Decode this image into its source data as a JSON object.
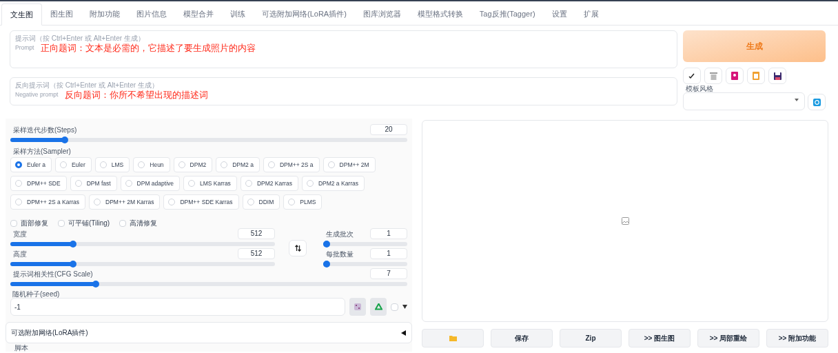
{
  "tabs": [
    {
      "label": "文生图",
      "selected": true
    },
    {
      "label": "图生图",
      "selected": false
    },
    {
      "label": "附加功能",
      "selected": false
    },
    {
      "label": "图片信息",
      "selected": false
    },
    {
      "label": "模型合并",
      "selected": false
    },
    {
      "label": "训练",
      "selected": false
    },
    {
      "label": "可选附加网络(LoRA插件)",
      "selected": false
    },
    {
      "label": "图库浏览器",
      "selected": false
    },
    {
      "label": "模型格式转换",
      "selected": false
    },
    {
      "label": "Tag反推(Tagger)",
      "selected": false
    },
    {
      "label": "设置",
      "selected": false
    },
    {
      "label": "扩展",
      "selected": false
    }
  ],
  "prompt": {
    "label": "提示词（按 Ctrl+Enter 或 Alt+Enter 生成）",
    "sublabel": "Prompt",
    "annotation": "正向题词：文本是必需的，它描述了要生成照片的内容"
  },
  "negative_prompt": {
    "label": "反向提示词（按 Ctrl+Enter 或 Alt+Enter 生成）",
    "sublabel": "Negative prompt",
    "annotation": "反向题词：你所不希望出现的描述词"
  },
  "generate_button": "生成",
  "styles": {
    "label": "模板风格"
  },
  "steps": {
    "label": "采样迭代步数(Steps)",
    "value": "20",
    "level": 0.13
  },
  "sampler": {
    "label": "采样方法(Sampler)",
    "options": [
      {
        "label": "Euler a",
        "selected": true
      },
      {
        "label": "Euler",
        "selected": false
      },
      {
        "label": "LMS",
        "selected": false
      },
      {
        "label": "Heun",
        "selected": false
      },
      {
        "label": "DPM2",
        "selected": false
      },
      {
        "label": "DPM2 a",
        "selected": false
      },
      {
        "label": "DPM++ 2S a",
        "selected": false
      },
      {
        "label": "DPM++ 2M",
        "selected": false
      },
      {
        "label": "DPM++ SDE",
        "selected": false
      },
      {
        "label": "DPM fast",
        "selected": false
      },
      {
        "label": "DPM adaptive",
        "selected": false
      },
      {
        "label": "LMS Karras",
        "selected": false
      },
      {
        "label": "DPM2 Karras",
        "selected": false
      },
      {
        "label": "DPM2 a Karras",
        "selected": false
      },
      {
        "label": "DPM++ 2S a Karras",
        "selected": false
      },
      {
        "label": "DPM++ 2M Karras",
        "selected": false
      },
      {
        "label": "DPM++ SDE Karras",
        "selected": false
      },
      {
        "label": "DDIM",
        "selected": false
      },
      {
        "label": "PLMS",
        "selected": false
      }
    ]
  },
  "checkboxes": [
    {
      "label": "面部修复",
      "checked": false
    },
    {
      "label": "可平铺(Tiling)",
      "checked": false
    },
    {
      "label": "高清修复",
      "checked": false
    }
  ],
  "width": {
    "label": "宽度",
    "value": "512",
    "level": 0.23
  },
  "height": {
    "label": "高度",
    "value": "512",
    "level": 0.23
  },
  "batch_count": {
    "label": "生成批次",
    "value": "1",
    "level": 0
  },
  "batch_size": {
    "label": "每批数量",
    "value": "1",
    "level": 0
  },
  "cfg_scale": {
    "label": "提示词相关性(CFG Scale)",
    "value": "7",
    "level": 0.21
  },
  "seed": {
    "label": "随机种子(seed)",
    "value": "-1",
    "extra_checked": false
  },
  "lora": {
    "title": "可选附加网络(LoRA插件)",
    "expanded": false
  },
  "script": {
    "label": "脚本"
  },
  "output_buttons": [
    "保存",
    "Zip",
    ">> 图生图",
    ">> 局部重绘",
    ">> 附加功能"
  ]
}
